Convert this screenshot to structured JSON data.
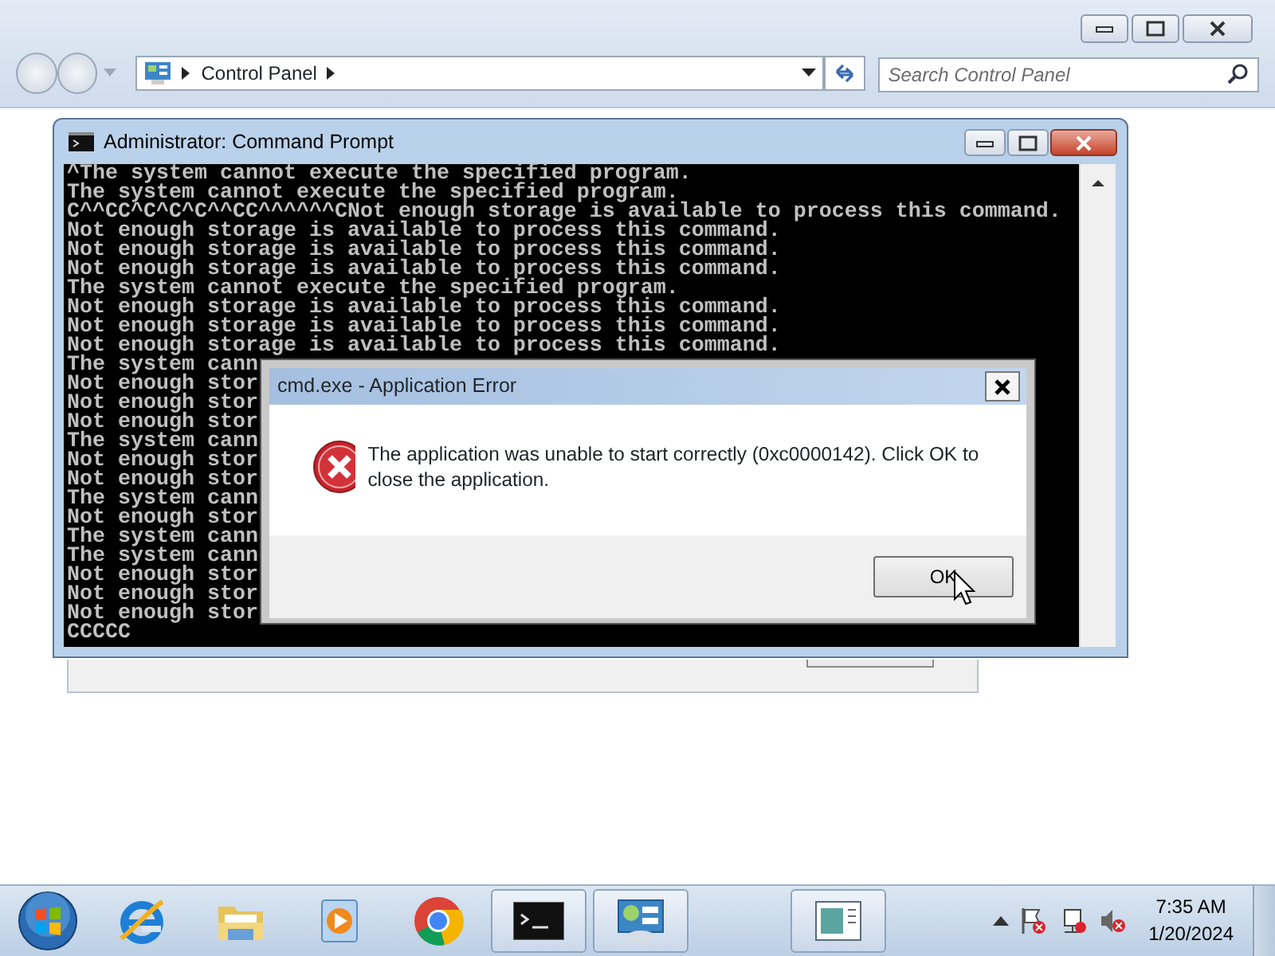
{
  "control_panel": {
    "address": {
      "path": "Control Panel"
    },
    "search": {
      "placeholder": "Search Control Panel"
    }
  },
  "command_prompt": {
    "title": "Administrator:  Command Prompt",
    "lines": [
      "^The system cannot execute the specified program.",
      "The system cannot execute the specified program.",
      "C^^CC^C^C^C^^CC^^^^^^CNot enough storage is available to process this command.",
      "Not enough storage is available to process this command.",
      "Not enough storage is available to process this command.",
      "Not enough storage is available to process this command.",
      "The system cannot execute the specified program.",
      "Not enough storage is available to process this command.",
      "Not enough storage is available to process this command.",
      "Not enough storage is available to process this command.",
      "The system cann",
      "Not enough stor",
      "Not enough stor",
      "Not enough stor",
      "The system cann",
      "Not enough stor",
      "Not enough stor",
      "The system cann",
      "Not enough stor",
      "The system cann",
      "The system cann",
      "Not enough stor",
      "Not enough stor",
      "Not enough stor",
      "CCCCC"
    ]
  },
  "error_dialog": {
    "title": "cmd.exe - Application Error",
    "message": "The application was unable to start correctly (0xc0000142). Click OK to close the application.",
    "buttons": [
      "OK"
    ]
  },
  "taskbar": {
    "apps": [
      {
        "kind": "browser-e",
        "running": false
      },
      {
        "kind": "folder",
        "running": false
      },
      {
        "kind": "media",
        "running": false
      },
      {
        "kind": "chrome",
        "running": false
      },
      {
        "kind": "console",
        "running": true
      },
      {
        "kind": "panel",
        "running": true
      },
      {
        "kind": "window",
        "running": true
      }
    ],
    "clock": {
      "time": "7:35 AM",
      "date": "1/20/2024"
    }
  }
}
